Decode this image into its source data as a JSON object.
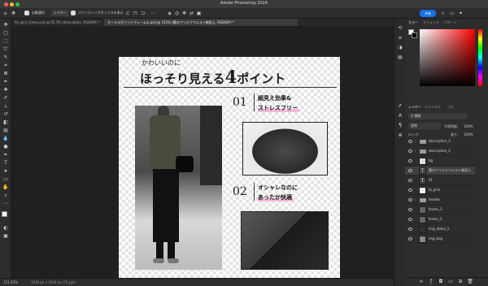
{
  "app": {
    "title": "Adobe Photoshop 2024",
    "share_label": "共有",
    "traffic_colors": [
      "#fe5f57",
      "#febc2e",
      "#28c840"
    ],
    "accent": "#1473e6"
  },
  "options_bar": {
    "auto_select_label": "自動選択",
    "layer_dropdown": "レイヤー",
    "bounding_box_label": "バウンディングボックスを表示"
  },
  "tabs": [
    {
      "label": "fix_wire_frame.psd @ 65.3% (description, RGB/8#) *",
      "active": false
    },
    {
      "label": "セールスポイントフレーム①.psd @ 152% (腰のフリルでウエスト細見え, RGB/8#) *",
      "active": true
    }
  ],
  "document": {
    "subtitle": "かわいいのに",
    "headline": "ほっそり見える",
    "headline_number": "4",
    "headline_tail": "ポイント",
    "point1": {
      "number": "01",
      "line1": "細見え効果&",
      "line2": "ストレスフリー"
    },
    "point2": {
      "number": "02",
      "line1": "オシャレなのに",
      "line2": "あったか快適"
    }
  },
  "status": {
    "zoom": "151.55%",
    "size": "1030 px x 1018 px (72 ppi)"
  },
  "panels": {
    "color_tabs": [
      "カラー",
      "スウォッチ",
      "パターン"
    ],
    "layer_tabs": [
      "レイヤー",
      "チャンネル",
      "パス"
    ],
    "kind_label": "Q 種類",
    "blend_mode": "通常",
    "opacity_label": "不透明度:",
    "opacity_value": "100%",
    "lock_label": "ロック:",
    "fill_label": "塗り:",
    "fill_value": "100%"
  },
  "layers": [
    {
      "name": "description_3",
      "type": "folder"
    },
    {
      "name": "description_2",
      "type": "folder"
    },
    {
      "name": "bg",
      "type": "image"
    },
    {
      "name": "腰のフリルでウエスト細見え",
      "type": "text"
    },
    {
      "name": "01",
      "type": "text"
    },
    {
      "name": "bl_pink",
      "type": "image"
    },
    {
      "name": "header",
      "type": "folder"
    },
    {
      "name": "frame_3",
      "type": "image"
    },
    {
      "name": "frame_2",
      "type": "image"
    },
    {
      "name": "img_detail_1",
      "type": "image"
    },
    {
      "name": "img_bag",
      "type": "image"
    }
  ]
}
